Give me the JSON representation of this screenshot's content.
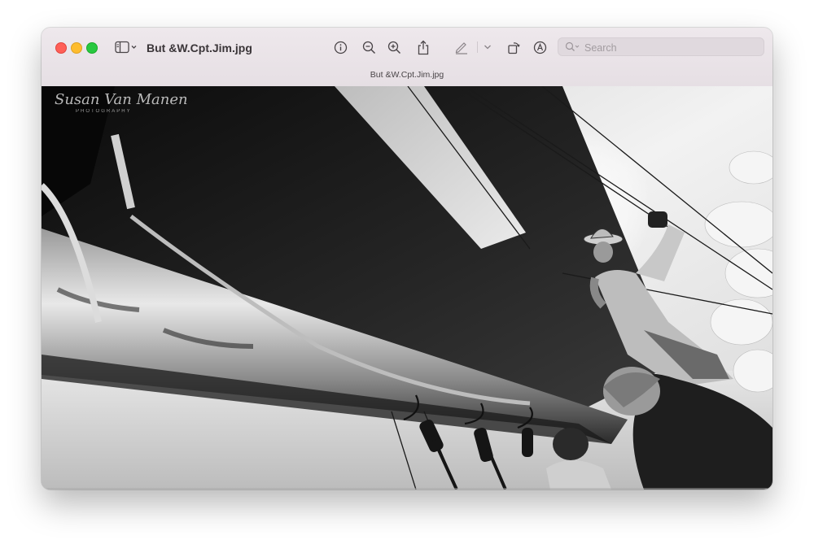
{
  "window": {
    "title": "But &W.Cpt.Jim.jpg",
    "subtitle": "But &W.Cpt.Jim.jpg"
  },
  "toolbar": {
    "sidebar_icon": "sidebar-icon",
    "info_icon": "info-icon",
    "zoom_out_icon": "zoom-out-icon",
    "zoom_in_icon": "zoom-in-icon",
    "share_icon": "share-icon",
    "markup_icon": "pen-icon",
    "rotate_icon": "rotate-icon",
    "annotate_icon": "annotate-icon"
  },
  "search": {
    "placeholder": "Search"
  },
  "image": {
    "watermark_line1": "Susan Van Manen",
    "watermark_line2": "PHOTOGRAPHY"
  },
  "colors": {
    "close": "#ff5f57",
    "minimize": "#febc2e",
    "maximize": "#28c840"
  }
}
